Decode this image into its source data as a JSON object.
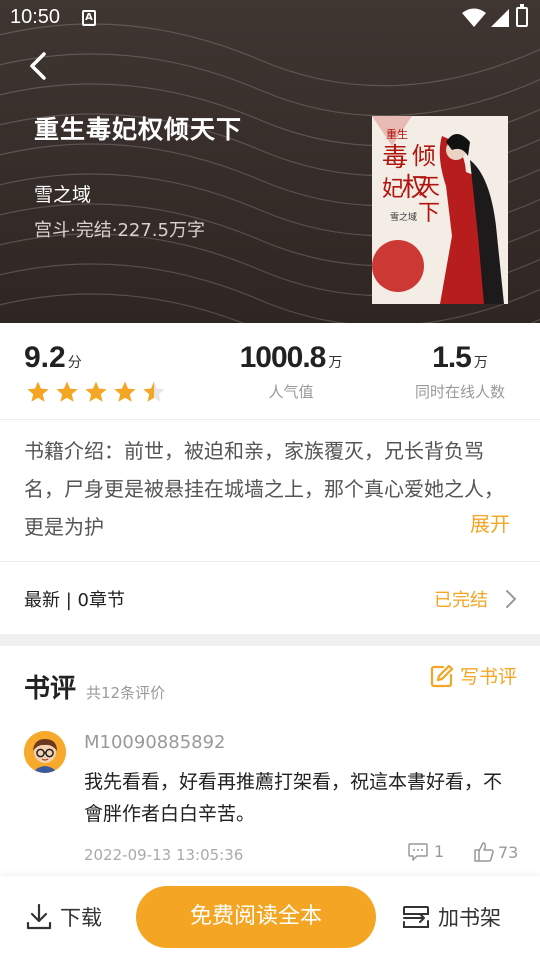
{
  "status_bar": {
    "time": "10:50",
    "a_badge": "A"
  },
  "book": {
    "title": "重生毒妃权倾天下",
    "author": "雪之域",
    "meta": "宫斗·完结·227.5万字",
    "cover_title_small": "重生",
    "cover_title": "毒妃权倾天下",
    "cover_author": "雪之域"
  },
  "stats": {
    "score": "9.2",
    "score_unit": "分",
    "stars_filled": 4.5,
    "popularity_value": "1000.8",
    "popularity_unit": "万",
    "popularity_label": "人气值",
    "online_value": "1.5",
    "online_unit": "万",
    "online_label": "同时在线人数"
  },
  "intro": {
    "text": "书籍介绍：前世，被迫和亲，家族覆灭，兄长背负骂名，尸身更是被悬挂在城墙之上，那个真心爱她之人，更是为护",
    "expand_label": "展开"
  },
  "latest": {
    "label": "最新 | 0章节",
    "status": "已完结"
  },
  "reviews": {
    "title": "书评",
    "count": "共12条评价",
    "write_label": "写书评",
    "items": [
      {
        "user": "M10090885892",
        "text": "我先看看，好看再推薦打架看，祝這本書好看，不會胖作者白白辛苦。",
        "time": "2022-09-13 13:05:36",
        "comments": "1",
        "likes": "73"
      }
    ]
  },
  "bottom_bar": {
    "download_label": "下载",
    "read_label": "免费阅读全本",
    "shelf_label": "加书架"
  },
  "colors": {
    "accent": "#f5a524",
    "hero_bg": "#3a302c",
    "star": "#f5a524"
  }
}
